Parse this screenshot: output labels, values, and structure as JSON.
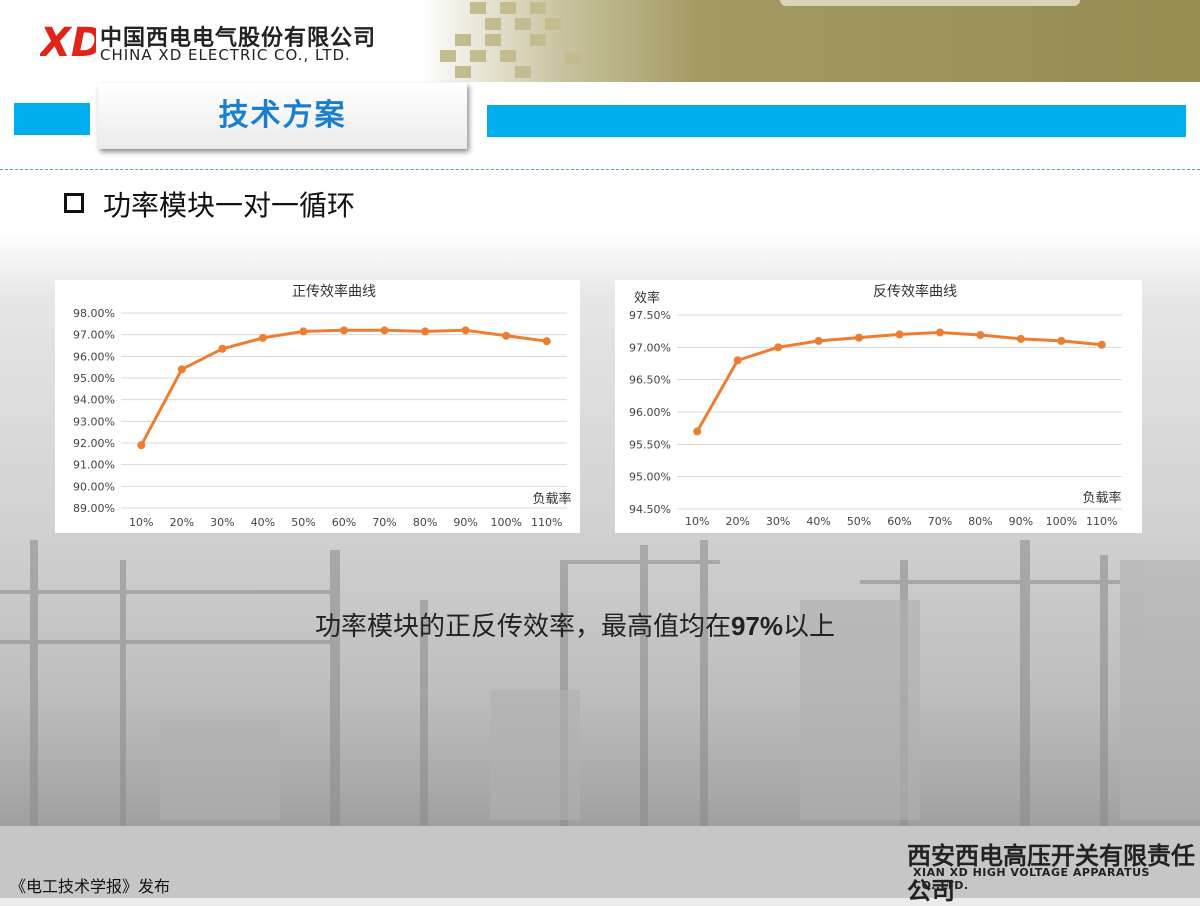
{
  "header": {
    "logo_text": "XD",
    "company_cn": "中国西电电气股份有限公司",
    "company_en": "CHINA XD ELECTRIC CO., LTD.",
    "brand_color": "#e2231a"
  },
  "slide": {
    "title": "技术方案",
    "accent_color": "#00aeef",
    "bullet": "功率模块一对一循环",
    "caption_before": "功率模块的正反传效率，最高值均在",
    "caption_highlight": "97%",
    "caption_after": "以上"
  },
  "footer": {
    "source": "《电工技术学报》发布",
    "company_cn": "西安西电高压开关有限责任公司",
    "company_en": "XIAN XD HIGH VOLTAGE APPARATUS CO.,LTD."
  },
  "chart_data": [
    {
      "type": "line",
      "title": "正传效率曲线",
      "ylabel": "",
      "xlabel": "负载率",
      "categories": [
        "10%",
        "20%",
        "30%",
        "40%",
        "50%",
        "60%",
        "70%",
        "80%",
        "90%",
        "100%",
        "110%"
      ],
      "y_ticks": [
        "89.00%",
        "90.00%",
        "91.00%",
        "92.00%",
        "93.00%",
        "94.00%",
        "95.00%",
        "96.00%",
        "97.00%",
        "98.00%"
      ],
      "ylim": [
        89,
        98
      ],
      "series": [
        {
          "values": [
            91.9,
            95.4,
            96.35,
            96.85,
            97.15,
            97.2,
            97.2,
            97.15,
            97.2,
            96.95,
            96.7
          ],
          "color": "#ed7d31"
        }
      ],
      "grid": true
    },
    {
      "type": "line",
      "title": "反传效率曲线",
      "ylabel": "效率",
      "xlabel": "负载率",
      "categories": [
        "10%",
        "20%",
        "30%",
        "40%",
        "50%",
        "60%",
        "70%",
        "80%",
        "90%",
        "100%",
        "110%"
      ],
      "y_ticks": [
        "94.50%",
        "95.00%",
        "95.50%",
        "96.00%",
        "96.50%",
        "97.00%",
        "97.50%"
      ],
      "ylim": [
        94.5,
        97.5
      ],
      "series": [
        {
          "values": [
            95.7,
            96.8,
            97.0,
            97.1,
            97.15,
            97.2,
            97.23,
            97.19,
            97.13,
            97.1,
            97.04
          ],
          "color": "#ed7d31"
        }
      ],
      "grid": true
    }
  ]
}
